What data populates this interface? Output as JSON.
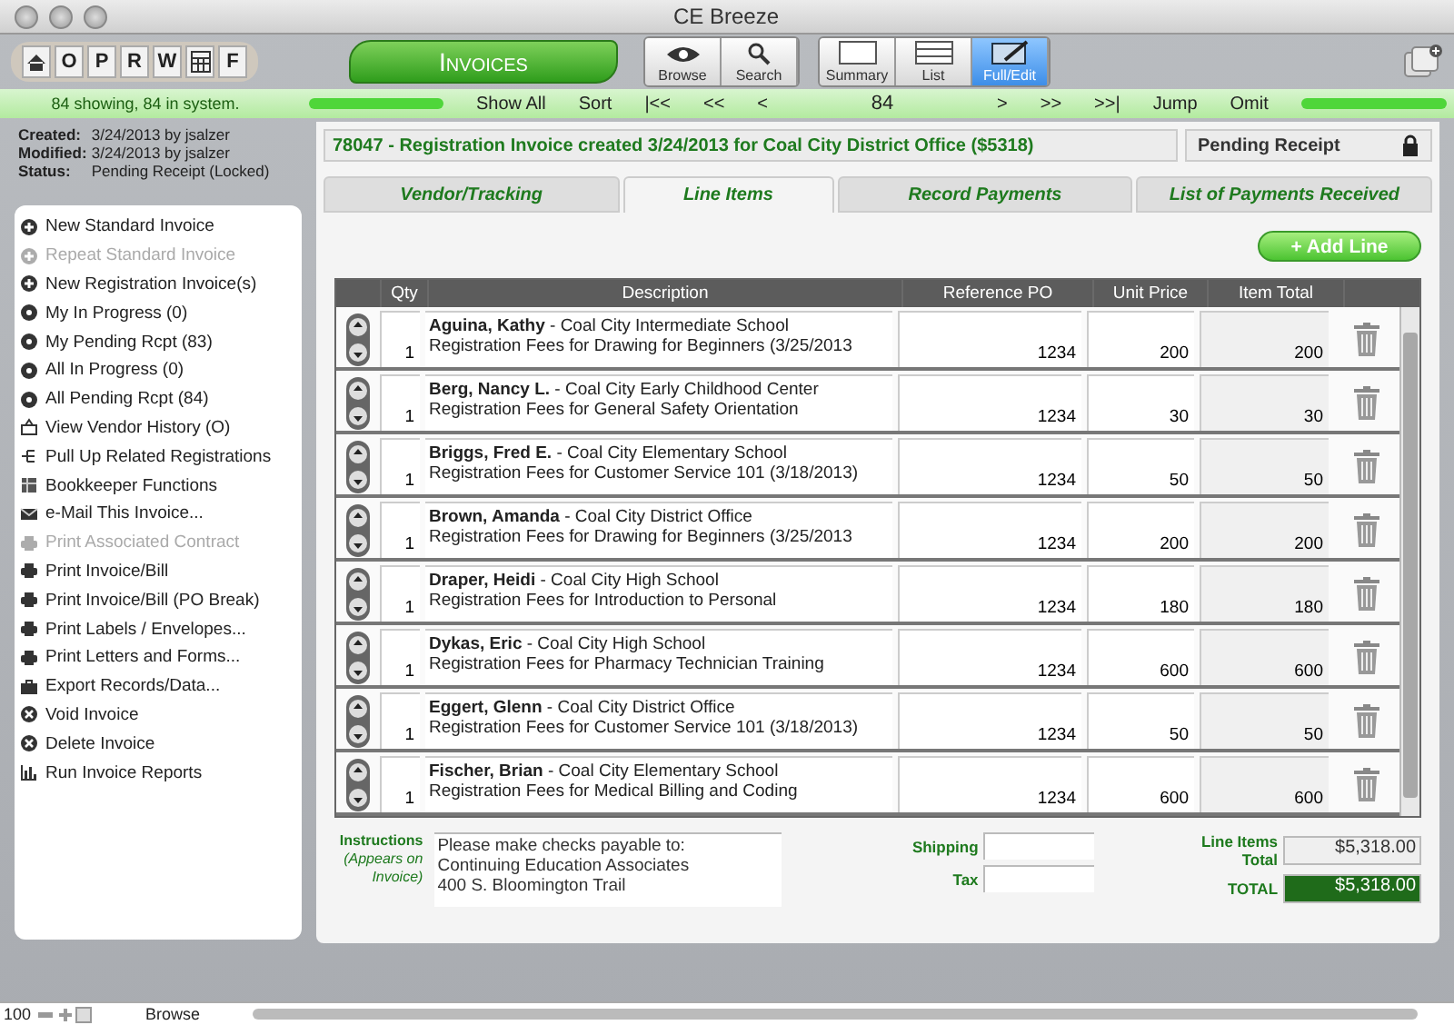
{
  "window": {
    "title": "CE Breeze"
  },
  "toolbar": {
    "nav_keys": [
      {
        "kind": "home"
      },
      {
        "kind": "letter",
        "label": "O"
      },
      {
        "kind": "letter",
        "label": "P"
      },
      {
        "kind": "letter",
        "label": "R"
      },
      {
        "kind": "letter",
        "label": "W"
      },
      {
        "kind": "calc"
      },
      {
        "kind": "letter",
        "label": "F"
      }
    ],
    "layout_title": "Invoices",
    "modes": [
      {
        "label": "Browse",
        "kind": "eye"
      },
      {
        "label": "Search",
        "kind": "search"
      }
    ],
    "views": [
      {
        "label": "Summary",
        "kind": "summary",
        "selected": false
      },
      {
        "label": "List",
        "kind": "list",
        "selected": false
      },
      {
        "label": "Full/Edit",
        "kind": "full",
        "selected": true
      }
    ]
  },
  "record_bar": {
    "count": "84 showing, 84 in system.",
    "items": [
      "Show All",
      "Sort",
      "|<<",
      "<<",
      "<",
      "84",
      ">",
      ">>",
      ">>|",
      "Jump",
      "Omit"
    ]
  },
  "record_info": [
    {
      "label": "Created:",
      "value": "3/24/2013 by jsalzer"
    },
    {
      "label": "Modified:",
      "value": "3/24/2013 by jsalzer"
    },
    {
      "label": "Status:",
      "value": "Pending Receipt (Locked)"
    }
  ],
  "sidebar": {
    "items": [
      {
        "label": "New Standard Invoice",
        "kind": "plus",
        "disabled": false
      },
      {
        "label": "Repeat Standard Invoice",
        "kind": "plus",
        "disabled": true
      },
      {
        "label": "New Registration Invoice(s)",
        "kind": "plus",
        "disabled": false
      },
      {
        "label": "My In Progress (0)",
        "kind": "target",
        "disabled": false
      },
      {
        "label": "My Pending Rcpt (83)",
        "kind": "target",
        "disabled": false
      },
      {
        "label": "All In Progress (0)",
        "kind": "target",
        "disabled": false
      },
      {
        "label": "All Pending Rcpt (84)",
        "kind": "target",
        "disabled": false
      },
      {
        "label": "View Vendor History (O)",
        "kind": "vendor",
        "disabled": false
      },
      {
        "label": "Pull Up Related Registrations",
        "kind": "tree",
        "disabled": false
      },
      {
        "label": "Bookkeeper Functions",
        "kind": "ledger",
        "disabled": false
      },
      {
        "label": "e-Mail This Invoice...",
        "kind": "mail",
        "disabled": false
      },
      {
        "label": "Print Associated Contract",
        "kind": "print",
        "disabled": true
      },
      {
        "label": "Print Invoice/Bill",
        "kind": "print",
        "disabled": false
      },
      {
        "label": "Print Invoice/Bill (PO Break)",
        "kind": "print",
        "disabled": false
      },
      {
        "label": "Print Labels / Envelopes...",
        "kind": "print",
        "disabled": false
      },
      {
        "label": "Print Letters and Forms...",
        "kind": "print",
        "disabled": false
      },
      {
        "label": "Export Records/Data...",
        "kind": "briefcase",
        "disabled": false
      },
      {
        "label": "Void Invoice",
        "kind": "x",
        "disabled": false
      },
      {
        "label": "Delete Invoice",
        "kind": "x",
        "disabled": false
      },
      {
        "label": "Run Invoice Reports",
        "kind": "chart",
        "disabled": false
      }
    ]
  },
  "record": {
    "heading": "78047 - Registration Invoice created 3/24/2013 for Coal City District Office ($5318)",
    "status": "Pending Receipt",
    "locked": true,
    "tabs": [
      {
        "label": "Vendor/Tracking",
        "selected": false
      },
      {
        "label": "Line Items",
        "selected": true
      },
      {
        "label": "Record Payments",
        "selected": false
      },
      {
        "label": "List of Payments Received",
        "selected": false
      }
    ],
    "add_button": "+ Add Line",
    "table": {
      "columns": [
        "Qty",
        "Description",
        "Reference PO",
        "Unit Price",
        "Item Total"
      ],
      "rows": [
        {
          "qty": "1",
          "description": [
            "**Aguina, Kathy**  - Coal City Intermediate School",
            "Registration Fees for Drawing for Beginners (3/25/2013"
          ],
          "po": "1234",
          "unit_price": "200",
          "total": "200"
        },
        {
          "qty": "1",
          "description": [
            "**Berg, Nancy L.** - Coal City Early Childhood Center",
            "Registration Fees for General Safety Orientation"
          ],
          "po": "1234",
          "unit_price": "30",
          "total": "30"
        },
        {
          "qty": "1",
          "description": [
            "**Briggs, Fred E.** - Coal City Elementary School",
            "Registration Fees for Customer Service 101 (3/18/2013)"
          ],
          "po": "1234",
          "unit_price": "50",
          "total": "50"
        },
        {
          "qty": "1",
          "description": [
            "**Brown, Amanda**   - Coal City District Office",
            "Registration Fees for Drawing for Beginners (3/25/2013"
          ],
          "po": "1234",
          "unit_price": "200",
          "total": "200"
        },
        {
          "qty": "1",
          "description": [
            "**Draper, Heidi**  - Coal City High School",
            "Registration Fees for Introduction to Personal"
          ],
          "po": "1234",
          "unit_price": "180",
          "total": "180"
        },
        {
          "qty": "1",
          "description": [
            "**Dykas, Eric**  - Coal City High School",
            "Registration Fees for Pharmacy Technician Training"
          ],
          "po": "1234",
          "unit_price": "600",
          "total": "600"
        },
        {
          "qty": "1",
          "description": [
            "**Eggert, Glenn**  - Coal City District Office",
            "Registration Fees for Customer Service 101 (3/18/2013)"
          ],
          "po": "1234",
          "unit_price": "50",
          "total": "50"
        },
        {
          "qty": "1",
          "description": [
            "**Fischer, Brian**  - Coal City Elementary School",
            "Registration Fees for Medical Billing and Coding"
          ],
          "po": "1234",
          "unit_price": "600",
          "total": "600"
        }
      ]
    },
    "instructions": {
      "label": "Instructions",
      "note": "(Appears on Invoice)",
      "lines": [
        "Please make checks payable to:",
        "Continuing Education Associates",
        "400 S. Bloomington Trail"
      ]
    },
    "shipping": {
      "label": "Shipping"
    },
    "tax": {
      "label": "Tax"
    },
    "line_items_total": {
      "label": "Line Items Total",
      "value": "$5,318.00"
    },
    "total": {
      "label": "TOTAL",
      "value": "$5,318.00"
    }
  },
  "status_bar": {
    "zoom": "100",
    "mode": "Browse"
  }
}
